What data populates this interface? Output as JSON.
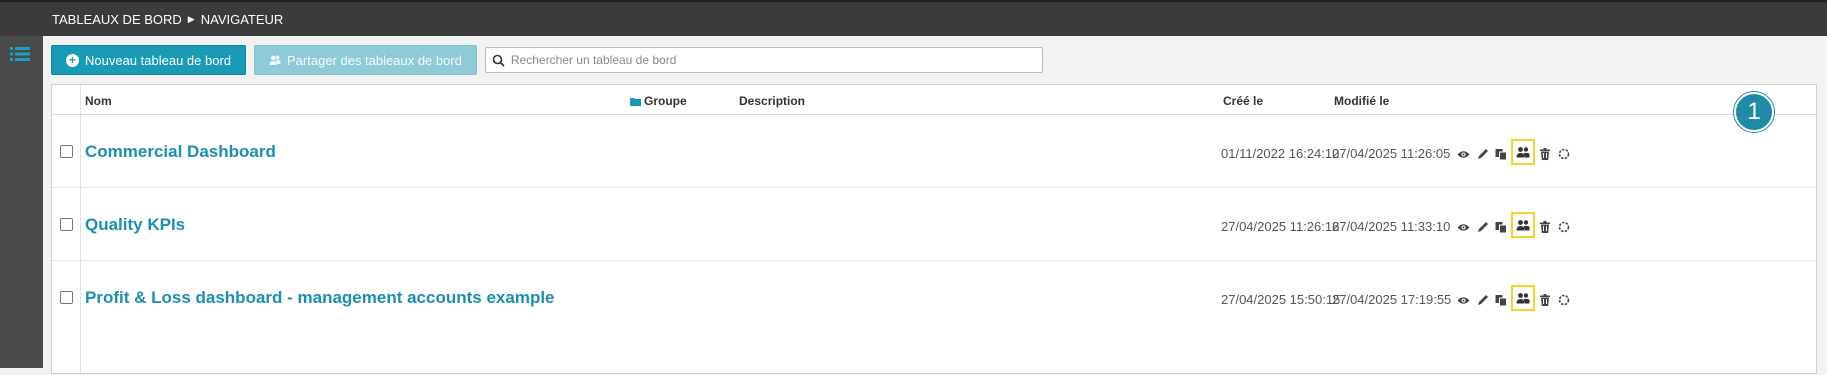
{
  "breadcrumb": {
    "first": "TABLEAUX DE BORD",
    "second": "NAVIGATEUR"
  },
  "toolbar": {
    "new_label": "Nouveau tableau de bord",
    "share_label": "Partager des tableaux de bord",
    "search_placeholder": "Rechercher un tableau de bord"
  },
  "table": {
    "headers": {
      "name": "Nom",
      "group": "Groupe",
      "description": "Description",
      "created": "Créé le",
      "modified": "Modifié le"
    },
    "rows": [
      {
        "name": "Commercial Dashboard",
        "created": "01/11/2022 16:24:10",
        "modified": "27/04/2025 11:26:05"
      },
      {
        "name": "Quality KPIs",
        "created": "27/04/2025 11:26:16",
        "modified": "27/04/2025 11:33:10"
      },
      {
        "name": "Profit & Loss dashboard - management accounts example",
        "created": "27/04/2025 15:50:15",
        "modified": "27/04/2025 17:19:55"
      }
    ]
  },
  "annotation": {
    "step_number": "1",
    "highlight_color": "#f3d22b",
    "badge_color": "#1e8aa6"
  },
  "icons": [
    "list-icon",
    "plus-circle-icon",
    "users-icon",
    "search-icon",
    "folder-icon",
    "eye-icon",
    "pencil-icon",
    "copy-icon",
    "share-users-icon",
    "trash-icon",
    "circle-dashed-icon"
  ],
  "colors": {
    "accent": "#1a9bb5",
    "link": "#1c8fb0",
    "topbar": "#3b3b3b"
  }
}
